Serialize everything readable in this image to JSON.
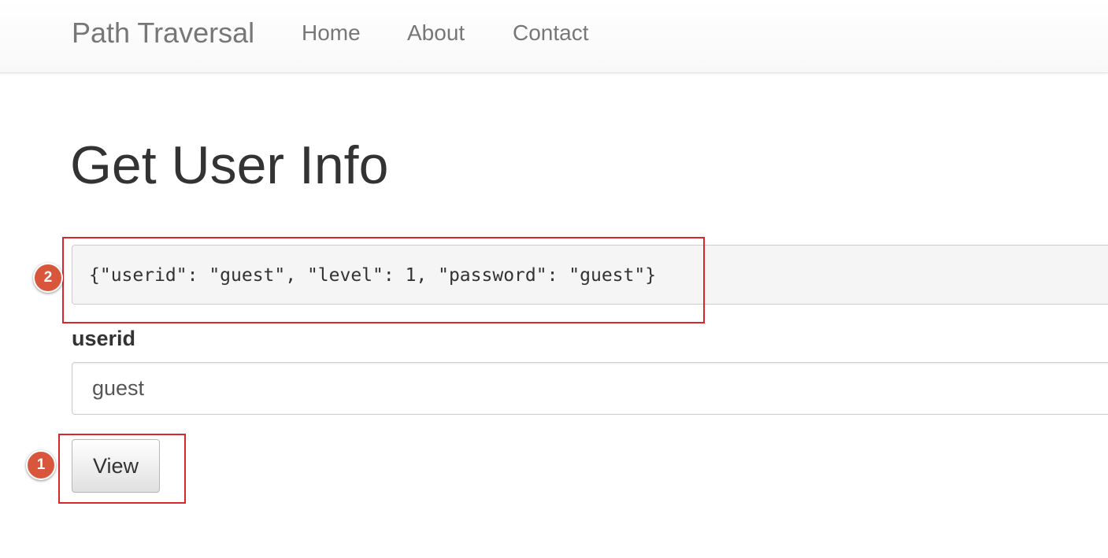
{
  "navbar": {
    "brand": "Path Traversal",
    "links": [
      {
        "label": "Home"
      },
      {
        "label": "About"
      },
      {
        "label": "Contact"
      }
    ]
  },
  "main": {
    "title": "Get User Info",
    "result_text": "{\"userid\": \"guest\", \"level\": 1, \"password\": \"guest\"}",
    "userid_label": "userid",
    "userid_value": "guest",
    "view_button_label": "View"
  },
  "annotations": {
    "badge_1": "1",
    "badge_2": "2",
    "highlight_color": "#d8262f",
    "badge_color": "#d8573c"
  }
}
